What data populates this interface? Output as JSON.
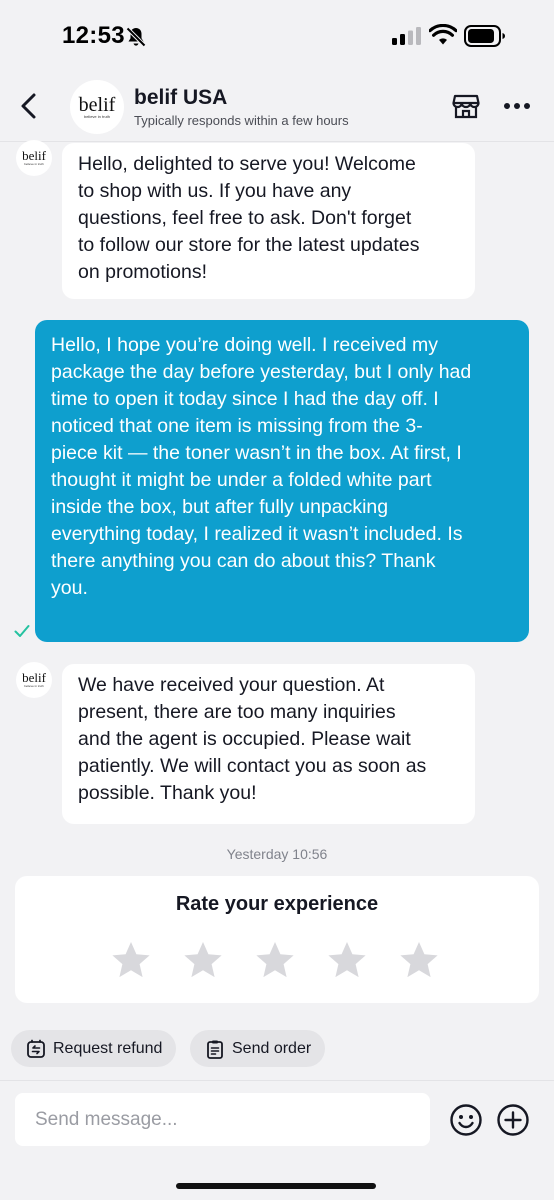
{
  "status_bar": {
    "time": "12:53"
  },
  "header": {
    "back_icon": "chevron-left-icon",
    "avatar_logo": "belif",
    "avatar_tagline": "believe in truth",
    "shop_name": "belif USA",
    "shop_status": "Typically responds within a few hours",
    "store_icon": "store-icon",
    "more_icon": "more-horizontal-icon"
  },
  "messages": [
    {
      "sender": "shop",
      "text": "Hello, delighted to serve you! Welcome\nto shop with us. If you have any\nquestions, feel free to ask. Don't forget\nto follow our store for the latest updates\non promotions!"
    },
    {
      "sender": "me",
      "text": "Hello, I hope you’re doing well. I received my\npackage the day before yesterday, but I only had\ntime to open it today since I had the day off. I\nnoticed that one item is missing from the 3-\npiece kit — the toner wasn’t in the box. At first, I\nthought it might be under a folded white part\ninside the box, but after fully unpacking\neverything today, I realized it wasn’t included. Is\nthere anything you can do about this? Thank\nyou.",
      "status": "sent"
    },
    {
      "sender": "shop",
      "text": "We have received your question. At\npresent, there are too many inquiries\nand the agent is occupied. Please wait\npatiently. We will contact you as soon as\npossible. Thank you!"
    }
  ],
  "timestamp": "Yesterday 10:56",
  "rating": {
    "title": "Rate your experience",
    "max_stars": 5,
    "selected": 0,
    "star_color": "#d8d8dc"
  },
  "actions": {
    "refund_label": "Request refund",
    "send_order_label": "Send order"
  },
  "composer": {
    "placeholder": "Send message..."
  },
  "colors": {
    "outgoing_bubble": "#0e9fce",
    "read_check": "#25c2a0"
  }
}
